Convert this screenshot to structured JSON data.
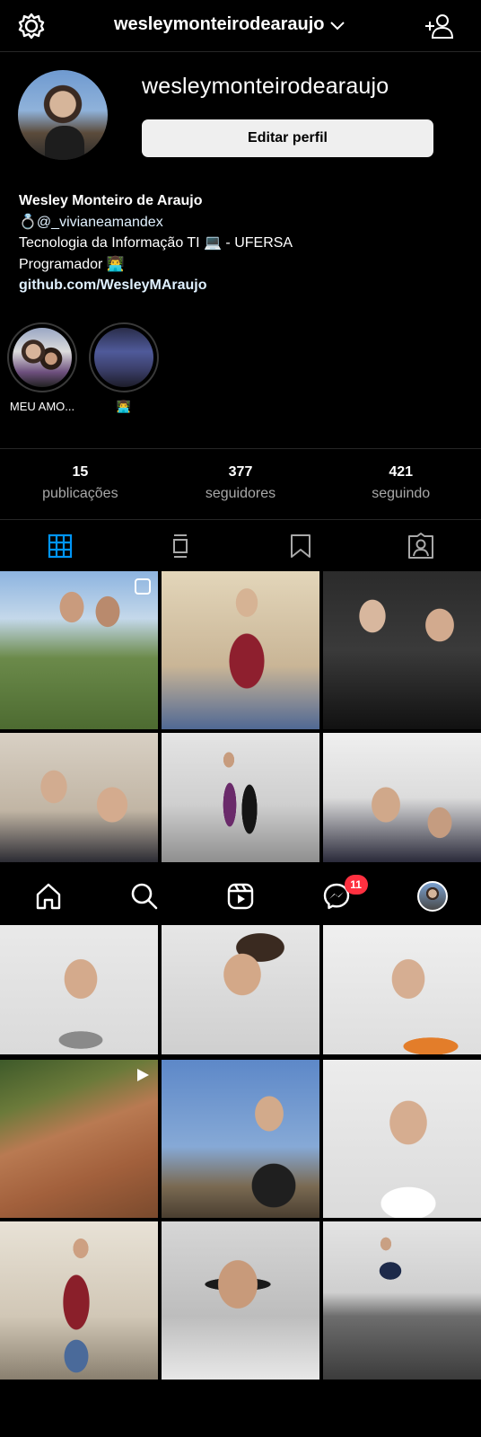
{
  "header": {
    "username": "wesleymonteirodearaujo",
    "settings_icon": "settings-icon",
    "dropdown_icon": "chevron-down-icon",
    "add_user_icon": "add-user-icon"
  },
  "profile": {
    "username": "wesleymonteirodearaujo",
    "edit_button": "Editar perfil",
    "full_name": "Wesley Monteiro de Araujo",
    "bio_line1": "💍@_vivianeamandex",
    "bio_line2": "Tecnologia da Informação TI 💻 - UFERSA",
    "bio_line3": "Programador 👨‍💻",
    "link": "github.com/WesleyMAraujo"
  },
  "highlights": [
    {
      "label": "MEU AMO..."
    },
    {
      "label": "👨‍💻"
    }
  ],
  "stats": [
    {
      "value": "15",
      "label": "publicações"
    },
    {
      "value": "377",
      "label": "seguidores"
    },
    {
      "value": "421",
      "label": "seguindo"
    }
  ],
  "tabs": [
    "grid-icon",
    "feed-icon",
    "saved-icon",
    "tagged-icon"
  ],
  "bottom_nav": {
    "items": [
      "home-icon",
      "search-icon",
      "reels-icon",
      "messenger-icon",
      "profile-avatar"
    ],
    "messenger_count": "11"
  },
  "colors": {
    "background": "#000000",
    "accent": "#0095f6",
    "badge": "#ff3040",
    "muted": "#a8a8a8"
  }
}
